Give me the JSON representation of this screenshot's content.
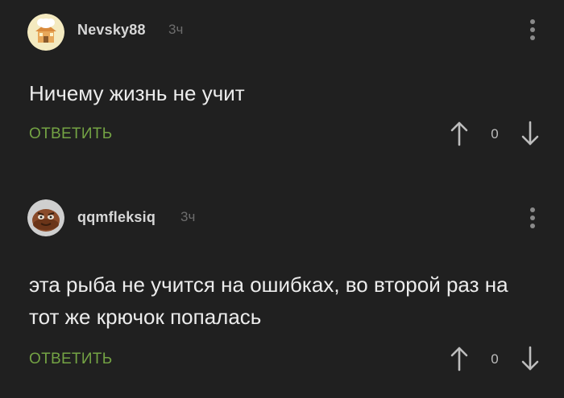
{
  "comments": [
    {
      "username": "Nevsky88",
      "time": "3ч",
      "text": "Ничему жизнь не учит",
      "reply_label": "ОТВЕТИТЬ",
      "rating": "0",
      "avatar_icon": "chef-house-avatar-icon"
    },
    {
      "username": "qqmfleksiq",
      "time": "3ч",
      "text": "эта рыба не учится на ошибках, во второй раз на тот же крючок попалась",
      "reply_label": "ОТВЕТИТЬ",
      "rating": "0",
      "avatar_icon": "cookie-character-avatar-icon"
    }
  ],
  "colors": {
    "background": "#202020",
    "reply_green": "#74a344",
    "text": "#ececec",
    "username": "#d7d7d7",
    "muted": "#6d6d6d"
  }
}
